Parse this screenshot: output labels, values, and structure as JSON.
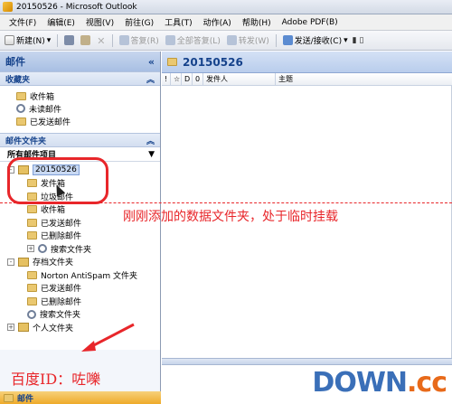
{
  "window": {
    "title": "20150526 - Microsoft Outlook"
  },
  "menu": [
    "文件(F)",
    "编辑(E)",
    "视图(V)",
    "前往(G)",
    "工具(T)",
    "动作(A)",
    "帮助(H)",
    "Adobe PDF(B)"
  ],
  "toolbar": {
    "new_label": "新建(N)",
    "reply_label": "答复(R)",
    "reply_all_label": "全部答复(L)",
    "forward_label": "转发(W)",
    "send_receive_label": "发送/接收(C)"
  },
  "nav": {
    "header": "邮件",
    "favorites_title": "收藏夹",
    "favorites": [
      "收件箱",
      "未读邮件",
      "已发送邮件"
    ],
    "mail_folders_title": "邮件文件夹",
    "all_items": "所有邮件项目",
    "tree": [
      {
        "label": "20150526",
        "level": 0,
        "expander": "-",
        "icon": "datafile",
        "selected": true
      },
      {
        "label": "发件箱",
        "level": 1,
        "icon": "folder"
      },
      {
        "label": "垃圾邮件",
        "level": 1,
        "icon": "folder"
      },
      {
        "label": "收件箱",
        "level": 1,
        "icon": "folder"
      },
      {
        "label": "已发送邮件",
        "level": 1,
        "icon": "folder"
      },
      {
        "label": "已删除邮件",
        "level": 1,
        "icon": "folder"
      },
      {
        "label": "搜索文件夹",
        "level": 1,
        "expander": "+",
        "icon": "search"
      },
      {
        "label": "存档文件夹",
        "level": 0,
        "expander": "-",
        "icon": "datafile"
      },
      {
        "label": "Norton AntiSpam 文件夹",
        "level": 1,
        "icon": "folder"
      },
      {
        "label": "已发送邮件",
        "level": 1,
        "icon": "folder"
      },
      {
        "label": "已删除邮件",
        "level": 1,
        "icon": "folder"
      },
      {
        "label": "搜索文件夹",
        "level": 1,
        "icon": "search"
      },
      {
        "label": "个人文件夹",
        "level": 0,
        "expander": "+",
        "icon": "datafile"
      }
    ],
    "bottom_label": "邮件"
  },
  "main": {
    "header": "20150526",
    "columns": [
      "!",
      "☆",
      "D",
      "0",
      "发件人",
      "主题"
    ]
  },
  "annotations": {
    "note": "刚刚添加的数据文件夹，处于临时挂载",
    "baidu_id": "百度ID：咗嚛",
    "watermark_main": "DOWN",
    "watermark_suffix": ".cc"
  },
  "colors": {
    "annotation": "#e8262a",
    "accent": "#15428b"
  }
}
